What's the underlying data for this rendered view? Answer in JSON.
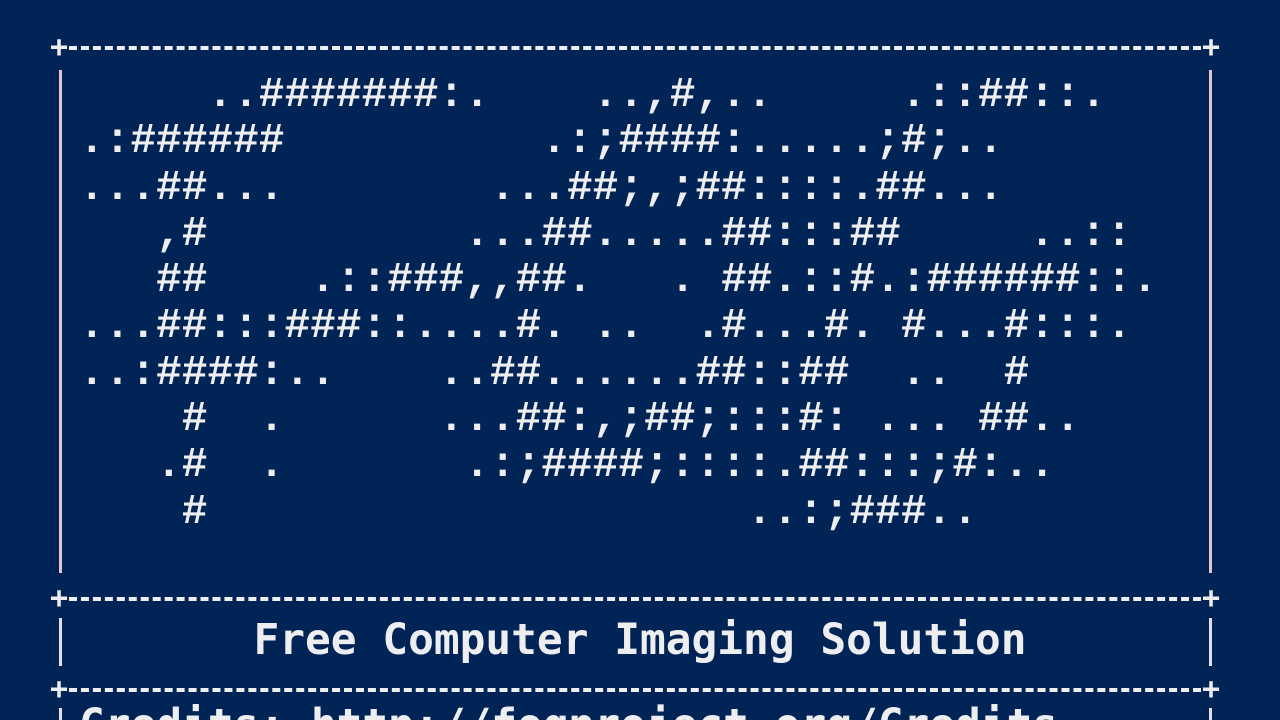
{
  "banner": {
    "ascii_art_lines": [
      "     ..#######:.    ..,#,..     .::##::.",
      ".:######          .:;####:.....;#;..",
      "...##...        ...##;,;##::::.##...",
      "   ,#          ...##.....##:::##     ..::",
      "   ##    .::###,,##.   . ##.::#.:######::.",
      "...##:::###::....#. ..  .#...#. #...#:::.",
      "..:####:..    ..##......##::##  ..  #",
      "    #  .      ...##:,;##;:::#: ... ##..",
      "   .#  .       .:;####;::::.##:::;#:..",
      "    #                     ..:;###.."
    ],
    "title": "Free Computer Imaging Solution",
    "credits_partial": "Credits: http://fogproject.org/Credits"
  },
  "colors": {
    "background": "#012456",
    "text": "#eeedf0",
    "border_pink": "#e7c3cf"
  }
}
